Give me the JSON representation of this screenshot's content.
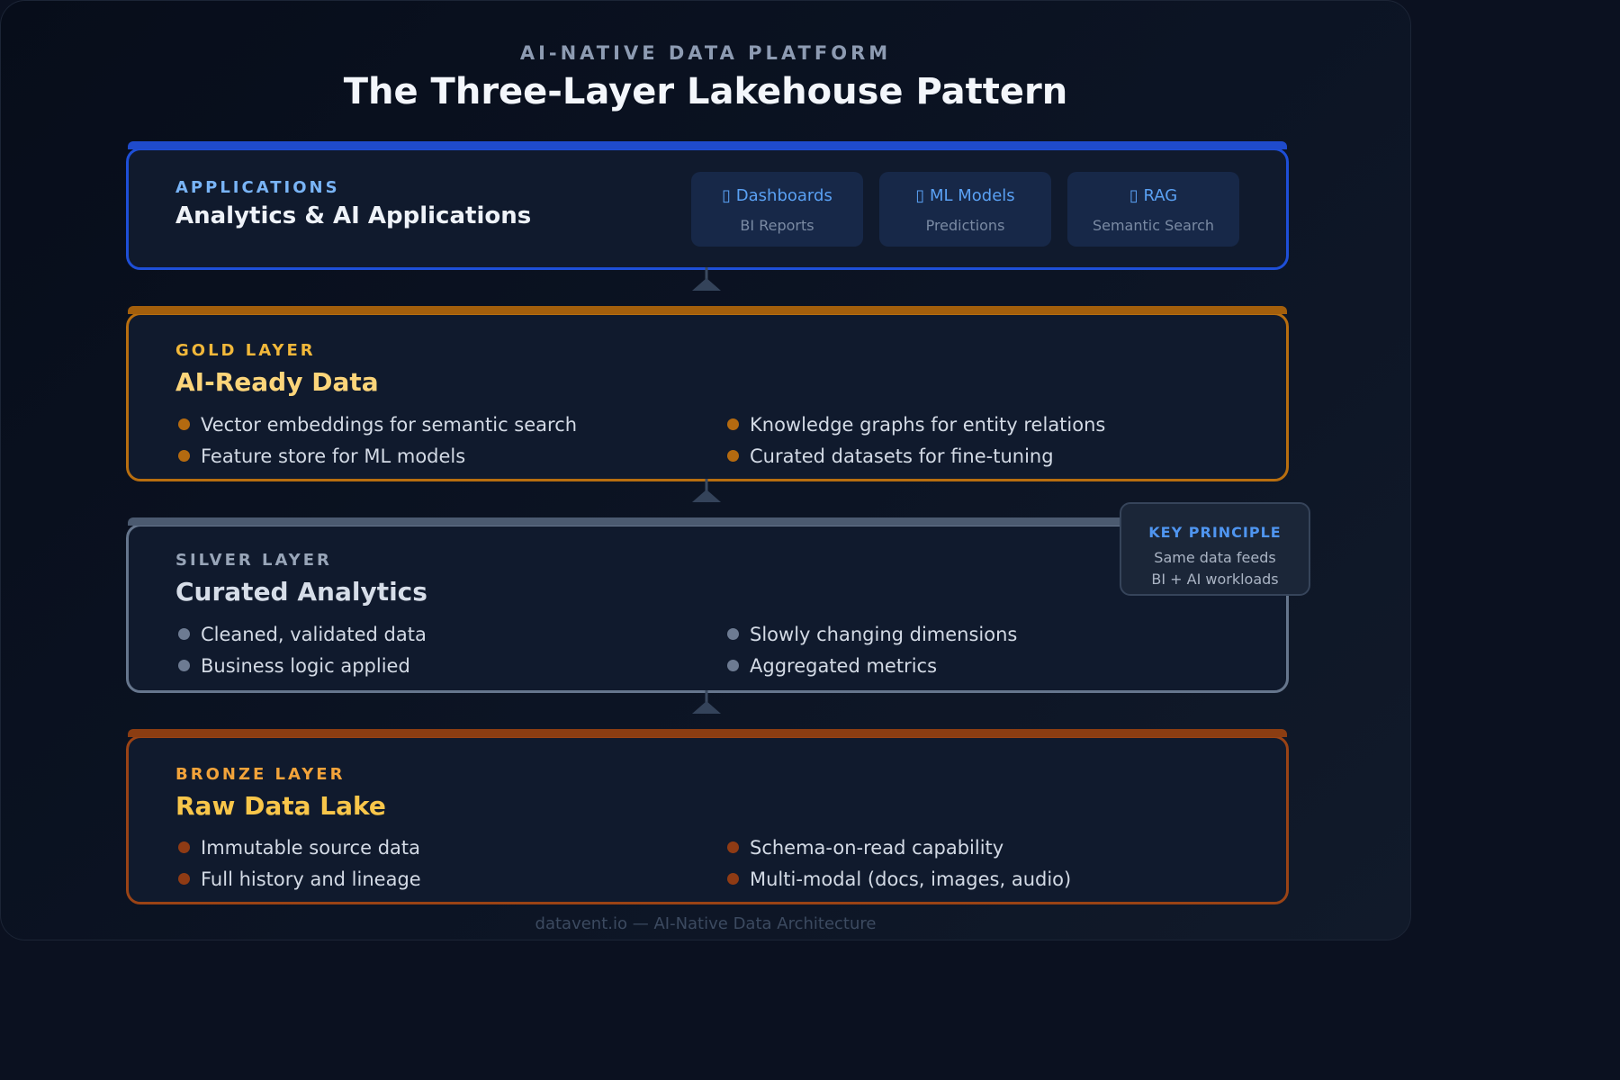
{
  "header": {
    "eyebrow": "AI-NATIVE DATA PLATFORM",
    "title": "The Three-Layer Lakehouse Pattern"
  },
  "applications": {
    "label": "APPLICATIONS",
    "heading": "Analytics & AI Applications",
    "color": "#1d4ed8",
    "chips": [
      {
        "icon": "chart-icon",
        "title": "▯ Dashboards",
        "subtitle": "BI Reports"
      },
      {
        "icon": "robot-icon",
        "title": "▯ ML Models",
        "subtitle": "Predictions"
      },
      {
        "icon": "search-icon",
        "title": "▯ RAG",
        "subtitle": "Semantic Search"
      }
    ]
  },
  "gold": {
    "label": "GOLD LAYER",
    "heading": "AI-Ready Data",
    "color": "#b86e0f",
    "items": [
      "Vector embeddings for semantic search",
      "Knowledge graphs for entity relations",
      "Feature store for ML models",
      "Curated datasets for fine-tuning"
    ]
  },
  "silver": {
    "label": "SILVER LAYER",
    "heading": "Curated Analytics",
    "color": "#64748b",
    "items": [
      "Cleaned, validated data",
      "Slowly changing dimensions",
      "Business logic applied",
      "Aggregated metrics"
    ]
  },
  "bronze": {
    "label": "BRONZE LAYER",
    "heading": "Raw Data Lake",
    "color": "#9a4315",
    "items": [
      "Immutable source data",
      "Schema-on-read capability",
      "Full history and lineage",
      "Multi-modal (docs, images, audio)"
    ]
  },
  "key_principle": {
    "title": "KEY PRINCIPLE",
    "line1": "Same data feeds",
    "line2": "BI + AI workloads"
  },
  "footer": "datavent.io — AI-Native Data Architecture"
}
